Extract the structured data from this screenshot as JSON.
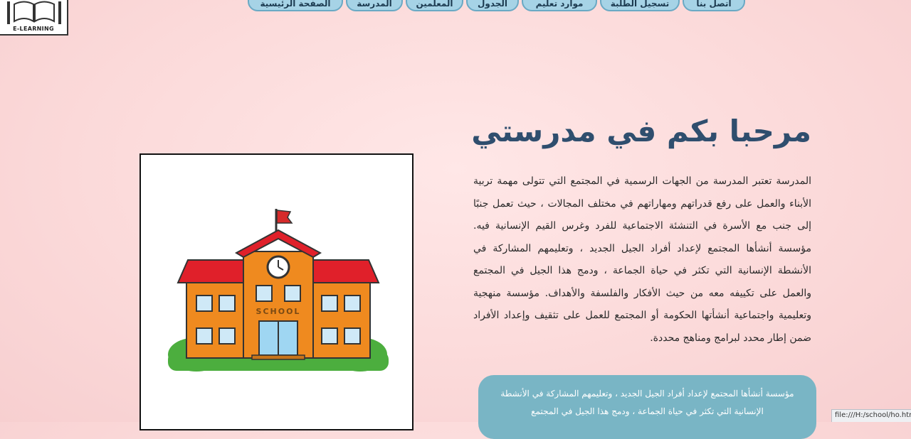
{
  "logo": {
    "text": "E-LEARNING"
  },
  "nav": {
    "items": [
      {
        "label": "اتصل بنا"
      },
      {
        "label": "تسجيل الطلبة"
      },
      {
        "label": "موارد تعليم"
      },
      {
        "label": "الجدول"
      },
      {
        "label": "المعلمين"
      },
      {
        "label": "المدرسة"
      },
      {
        "label": "الصفحة الرئيسية"
      }
    ]
  },
  "main": {
    "title": "مرحبا بكم في مدرستي",
    "description": "المدرسة تعتبر المدرسة من الجهات الرسمية في المجتمع التي تتولى مهمة تربية الأبناء والعمل على رفع قدراتهم ومهاراتهم في مختلف المجالات ، حيث تعمل جنبًا إلى جنب مع الأسرة في التنشئة الاجتماعية للفرد وغرس القيم الإنسانية فيه. مؤسسة أنشأها المجتمع لإعداد أفراد الجيل الجديد ، وتعليمهم المشاركة في الأنشطة الإنسانية التي تكثر في حياة الجماعة ، ودمج هذا الجيل في المجتمع والعمل على تكييفه معه من حيث الأفكار والفلسفة والأهداف. مؤسسة منهجية وتعليمية واجتماعية أنشأتها الحكومة أو المجتمع للعمل على تثقيف وإعداد الأفراد ضمن إطار محدد لبرامج ومناهج محددة.",
    "box_text": "مؤسسة أنشأها المجتمع لإعداد أفراد الجيل الجديد ، وتعليمهم المشاركة في الأنشطة الإنسانية التي تكثر في حياة الجماعة ، ودمج هذا الجيل في المجتمع",
    "school_sign": "SCHOOL"
  },
  "status_bar": {
    "url": "file:///H:/school/ho.html"
  },
  "colors": {
    "nav_bg": "#a6d3e6",
    "title": "#2f4e6e",
    "box_bg": "#79b5c5",
    "page_bg": "#fbd9d9"
  }
}
